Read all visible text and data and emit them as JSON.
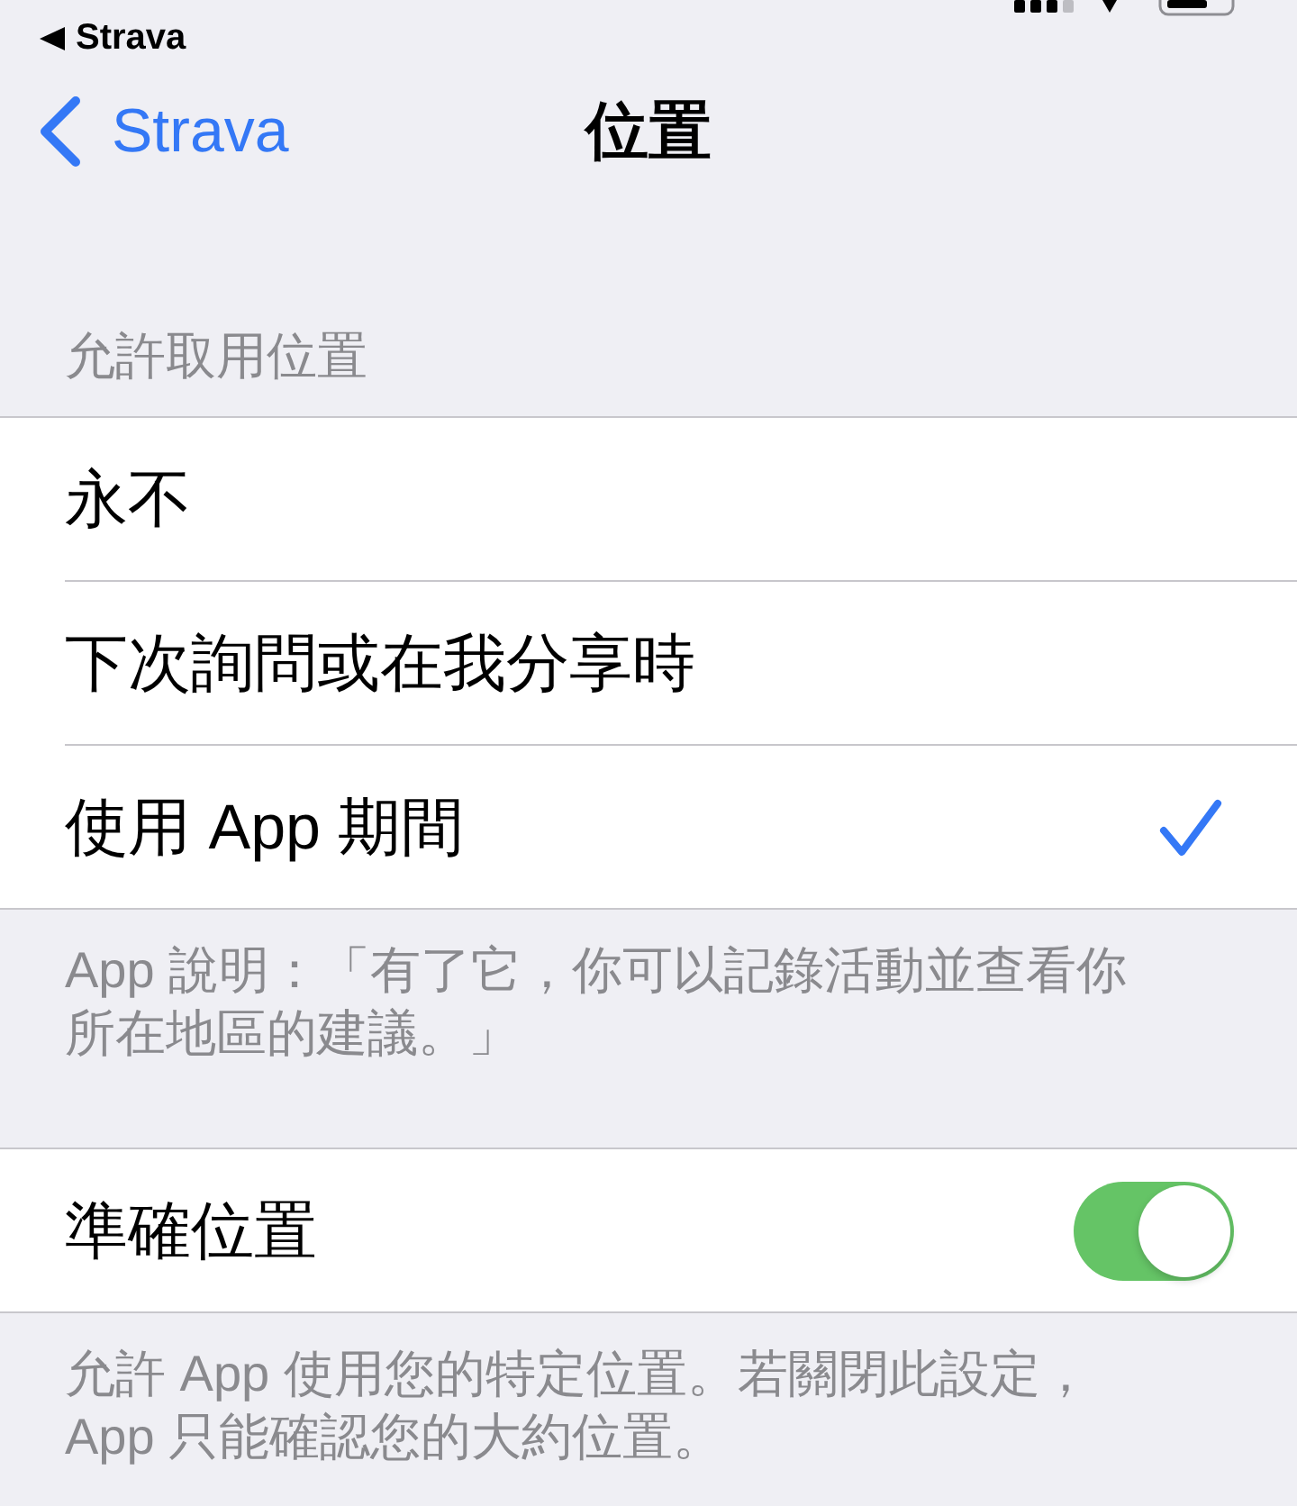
{
  "status_bar": {
    "back_app": "Strava"
  },
  "nav_bar": {
    "back_label": "Strava",
    "title": "位置"
  },
  "section_header": "允許取用位置",
  "options": [
    {
      "label": "永不",
      "selected": false
    },
    {
      "label": "下次詢問或在我分享時",
      "selected": false
    },
    {
      "label": "使用 App 期間",
      "selected": true
    }
  ],
  "options_footer": "App 說明：「有了它，你可以記錄活動並查看你所在地區的建議。」",
  "precise_location": {
    "label": "準確位置",
    "on": true
  },
  "precise_footer": "允許 App 使用您的特定位置。若關閉此設定，App 只能確認您的大約位置。"
}
